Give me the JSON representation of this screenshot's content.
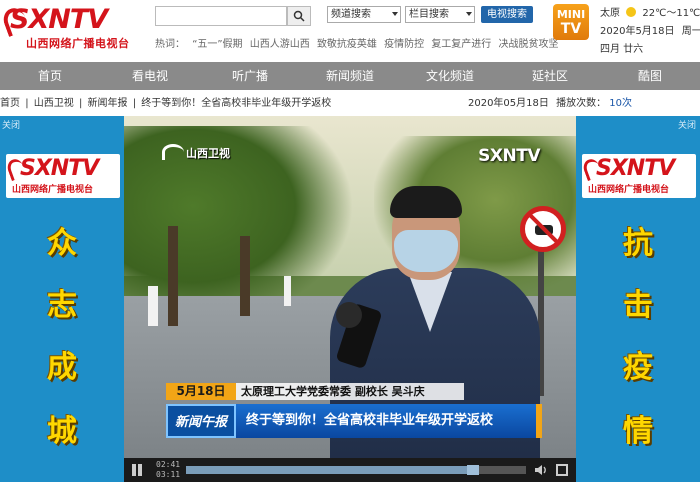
{
  "header": {
    "logo_text": "SXNTV",
    "logo_subtitle": "山西网络广播电视台",
    "search": {
      "value": "",
      "placeholder": ""
    },
    "select_channel": "频道搜索",
    "select_column": "栏目搜索",
    "tv_search_label": "电视搜索",
    "hot_label": "热词：",
    "hot_words": [
      "“五一”假期",
      "山西人游山西",
      "致敬抗疫英雄",
      "疫情防控",
      "复工复产进行",
      "决战脱贫攻坚"
    ],
    "mini_tv": {
      "line1": "MINI",
      "line2": "TV"
    },
    "weather": {
      "city": "太原",
      "temp": "22℃～11℃"
    },
    "date": "2020年5月18日",
    "weekday": "周一",
    "lunar": "四月 廿六"
  },
  "nav": {
    "items": [
      "首页",
      "看电视",
      "听广播",
      "新闻频道",
      "文化频道",
      "延社区",
      "酷图"
    ]
  },
  "breadcrumb": {
    "items": [
      "首页",
      "山西卫视",
      "新闻年报",
      "终于等到你！全省高校非毕业年级开学返校"
    ],
    "separator": "|",
    "date": "2020年05月18日",
    "play_count_label": "播放次数：",
    "play_count": "10次"
  },
  "side_left": {
    "close_label": "关闭",
    "logo_text": "SXNTV",
    "logo_subtitle": "山西网络广播电视台",
    "slogan": [
      "众",
      "志",
      "成",
      "城"
    ]
  },
  "side_right": {
    "close_label": "关闭",
    "logo_text": "SXNTV",
    "logo_subtitle": "山西网络广播电视台",
    "slogan": [
      "抗",
      "击",
      "疫",
      "情"
    ]
  },
  "video": {
    "station_logo": "山西卫视",
    "bug": "SXNTV",
    "date_tag": "5月18日",
    "guest_caption": "太原理工大学党委常委  副校长  吴斗庆",
    "program_label": "新闻午报",
    "headline": "终于等到你！全省高校非毕业年级开学返校"
  },
  "player": {
    "current_time": "02:41",
    "total_time": "03:11",
    "progress": 0.845
  }
}
